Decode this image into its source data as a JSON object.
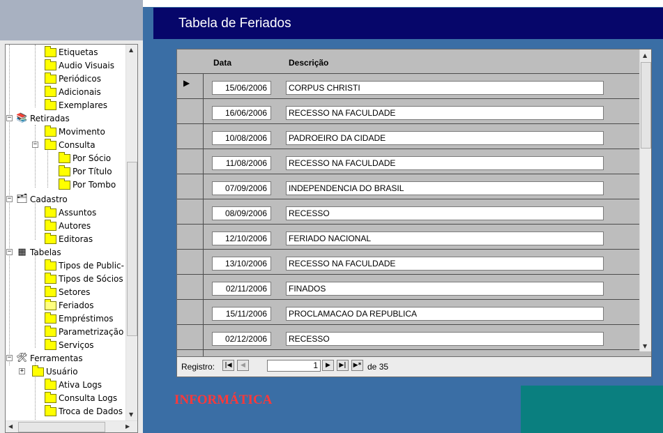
{
  "form_title": "Tabela de Feriados",
  "columns": {
    "date": "Data",
    "description": "Descrição"
  },
  "records": [
    {
      "date": "15/06/2006",
      "description": "CORPUS CHRISTI"
    },
    {
      "date": "16/06/2006",
      "description": "RECESSO NA FACULDADE"
    },
    {
      "date": "10/08/2006",
      "description": "PADROEIRO DA CIDADE"
    },
    {
      "date": "11/08/2006",
      "description": "RECESSO NA FACULDADE"
    },
    {
      "date": "07/09/2006",
      "description": "INDEPENDENCIA DO BRASIL"
    },
    {
      "date": "08/09/2006",
      "description": "RECESSO"
    },
    {
      "date": "12/10/2006",
      "description": "FERIADO NACIONAL"
    },
    {
      "date": "13/10/2006",
      "description": "RECESSO NA FACULDADE"
    },
    {
      "date": "02/11/2006",
      "description": "FINADOS"
    },
    {
      "date": "15/11/2006",
      "description": "PROCLAMACAO DA REPUBLICA"
    },
    {
      "date": "02/12/2006",
      "description": "RECESSO"
    }
  ],
  "navigation": {
    "label": "Registro:",
    "current": "1",
    "of_label": "de",
    "total": "35"
  },
  "footer_label": "INFORMÁTICA",
  "tree": [
    {
      "label": "Etiquetas",
      "icon": "folder-icon"
    },
    {
      "label": "Audio Visuais",
      "icon": "folder-icon"
    },
    {
      "label": "Periódicos",
      "icon": "folder-icon"
    },
    {
      "label": "Adicionais",
      "icon": "folder-icon"
    },
    {
      "label": "Exemplares",
      "icon": "folder-icon"
    },
    {
      "label": "Retiradas",
      "icon": "books-icon"
    },
    {
      "label": "Movimento",
      "icon": "folder-icon"
    },
    {
      "label": "Consulta",
      "icon": "folder-icon"
    },
    {
      "label": "Por Sócio",
      "icon": "folder-icon"
    },
    {
      "label": "Por Título",
      "icon": "folder-icon"
    },
    {
      "label": "Por Tombo",
      "icon": "folder-icon"
    },
    {
      "label": "Cadastro",
      "icon": "registry-icon"
    },
    {
      "label": "Assuntos",
      "icon": "folder-icon"
    },
    {
      "label": "Autores",
      "icon": "folder-icon"
    },
    {
      "label": "Editoras",
      "icon": "folder-icon"
    },
    {
      "label": "Tabelas",
      "icon": "table-icon"
    },
    {
      "label": "Tipos de Public-",
      "icon": "folder-icon"
    },
    {
      "label": "Tipos de Sócios",
      "icon": "folder-icon"
    },
    {
      "label": "Setores",
      "icon": "folder-icon"
    },
    {
      "label": "Feriados",
      "icon": "open-folder-icon"
    },
    {
      "label": "Empréstimos",
      "icon": "folder-icon"
    },
    {
      "label": "Parametrização",
      "icon": "folder-icon"
    },
    {
      "label": "Serviços",
      "icon": "folder-icon"
    },
    {
      "label": "Ferramentas",
      "icon": "tools-icon"
    },
    {
      "label": "Usuário",
      "icon": "folder-icon"
    },
    {
      "label": "Ativa Logs",
      "icon": "folder-icon"
    },
    {
      "label": "Consulta Logs",
      "icon": "folder-icon"
    },
    {
      "label": "Troca de Dados",
      "icon": "folder-icon"
    }
  ],
  "colors": {
    "title_bar": "#06066a",
    "background": "#3a6ea5",
    "form": "#bdbdbd",
    "footer_label": "#ff3838",
    "teal_box": "#0a7f7f",
    "folder": "#ffff00"
  }
}
